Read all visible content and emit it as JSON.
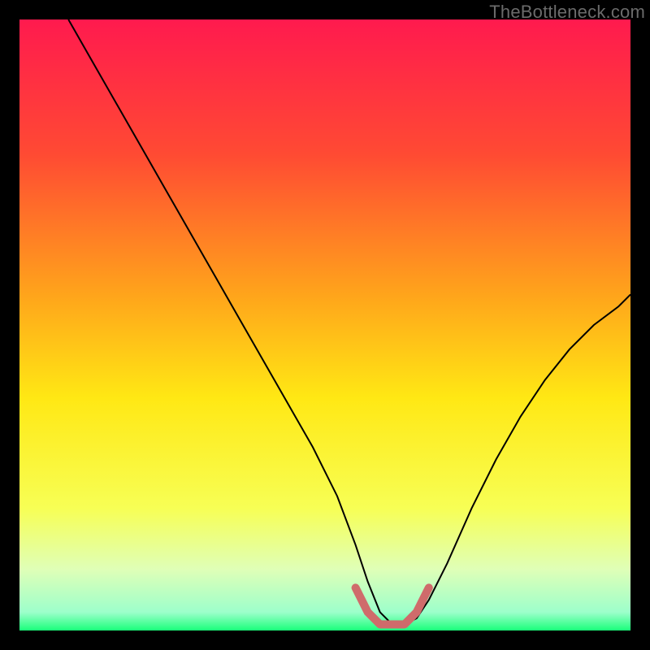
{
  "watermark": "TheBottleneck.com",
  "chart_data": {
    "type": "line",
    "title": "",
    "xlabel": "",
    "ylabel": "",
    "xlim": [
      0,
      100
    ],
    "ylim": [
      0,
      100
    ],
    "grid": false,
    "legend": false,
    "background_gradient": {
      "stops": [
        {
          "pos": 0.0,
          "color": "#ff1a4e"
        },
        {
          "pos": 0.22,
          "color": "#ff4a33"
        },
        {
          "pos": 0.45,
          "color": "#ffa41b"
        },
        {
          "pos": 0.62,
          "color": "#ffe814"
        },
        {
          "pos": 0.8,
          "color": "#f7ff55"
        },
        {
          "pos": 0.9,
          "color": "#dfffb7"
        },
        {
          "pos": 0.97,
          "color": "#9dffcb"
        },
        {
          "pos": 1.0,
          "color": "#1aff7a"
        }
      ]
    },
    "series": [
      {
        "name": "bottleneck-curve",
        "color": "#000000",
        "x": [
          8,
          12,
          16,
          20,
          24,
          28,
          32,
          36,
          40,
          44,
          48,
          52,
          55,
          57,
          59,
          61,
          63,
          65,
          67,
          70,
          74,
          78,
          82,
          86,
          90,
          94,
          98,
          100
        ],
        "y": [
          100,
          93,
          86,
          79,
          72,
          65,
          58,
          51,
          44,
          37,
          30,
          22,
          14,
          8,
          3,
          1,
          1,
          2,
          5,
          11,
          20,
          28,
          35,
          41,
          46,
          50,
          53,
          55
        ]
      },
      {
        "name": "optimal-band",
        "color": "#cf6b6b",
        "x": [
          55,
          57,
          59,
          61,
          63,
          65,
          67
        ],
        "y": [
          7,
          3,
          1,
          1,
          1,
          3,
          7
        ]
      }
    ],
    "annotations": []
  }
}
